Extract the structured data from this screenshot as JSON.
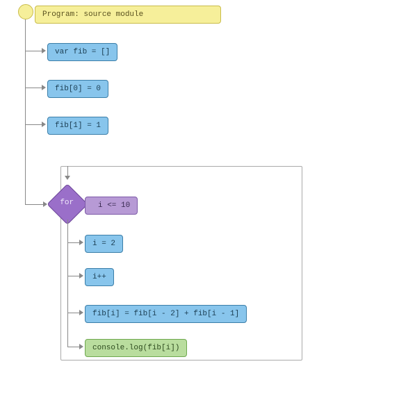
{
  "program": {
    "title": "Program: source module"
  },
  "statements": {
    "s1": "var fib = []",
    "s2": "fib[0] = 0",
    "s3": "fib[1] = 1"
  },
  "loop": {
    "keyword": "for",
    "condition": "i <= 10",
    "init": "i = 2",
    "update": "i++",
    "body": "fib[i] = fib[i - 2] + fib[i - 1]",
    "log": "console.log(fib[i])"
  }
}
